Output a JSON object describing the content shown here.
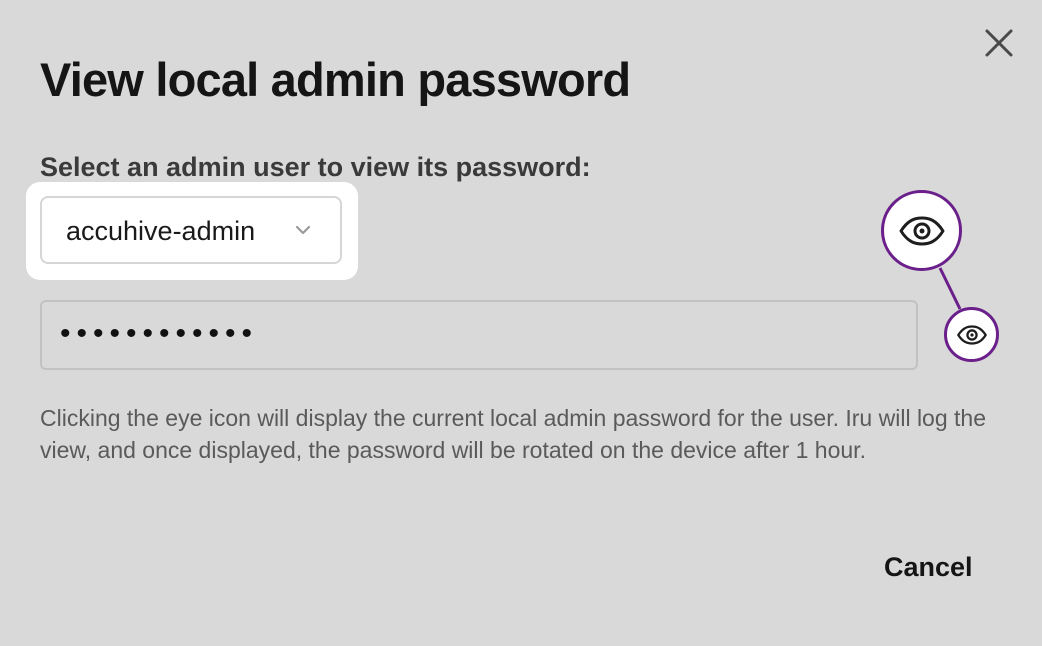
{
  "dialog": {
    "title": "View local admin password",
    "select_label": "Select an admin user to view its password:",
    "admin_user_select": {
      "selected_value": "accuhive-admin"
    },
    "password_field": {
      "masked_value": "••••••••••••"
    },
    "help_text": "Clicking the eye icon will display the current local admin password for the user. Iru will log the view, and once displayed, the password will be rotated on the device after 1 hour.",
    "cancel_label": "Cancel"
  },
  "icons": {
    "close": "close-icon",
    "chevron": "chevron-down-icon",
    "eye": "eye-icon"
  },
  "colors": {
    "background": "#d9d9d9",
    "callout_accent": "#6a1f8a",
    "text_primary": "#151515",
    "text_secondary": "#5a5a5a"
  }
}
